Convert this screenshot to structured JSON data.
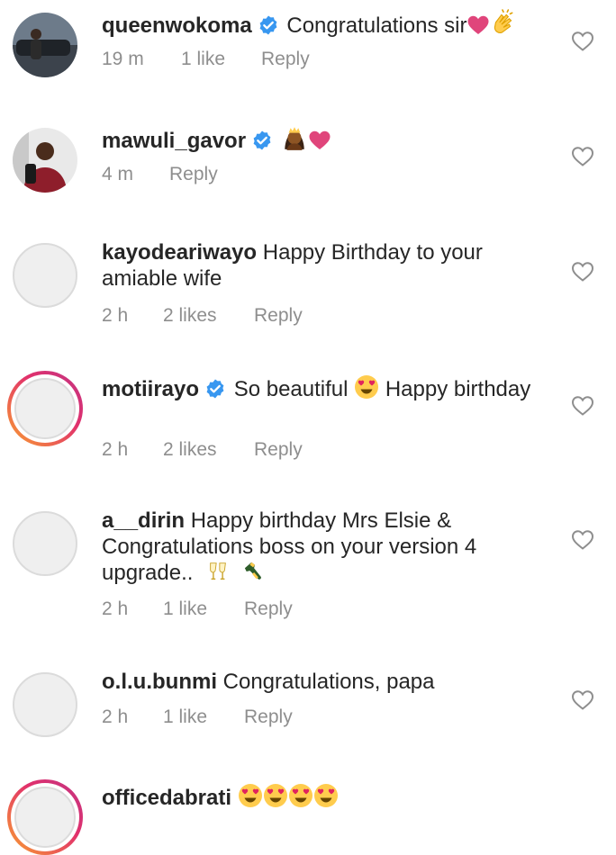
{
  "colors": {
    "text": "#262626",
    "muted": "#8e8e8e",
    "verified": "#3897f0",
    "heart_emoji": "#e0457b"
  },
  "comments": [
    {
      "username": "queenwokoma",
      "verified": true,
      "text": "Congratulations sir",
      "emojis": [
        "heart",
        "clapping-hands"
      ],
      "time": "19 m",
      "likes": "1 like",
      "reply": "Reply",
      "avatar": "photo"
    },
    {
      "username": "mawuli_gavor",
      "verified": true,
      "text": "",
      "emojis": [
        "princess",
        "heart"
      ],
      "time": "4 m",
      "likes": "",
      "reply": "Reply",
      "avatar": "photo"
    },
    {
      "username": "kayodeariwayo",
      "verified": false,
      "text": "Happy Birthday to your amiable wife",
      "time": "2 h",
      "likes": "2 likes",
      "reply": "Reply",
      "avatar": "blank"
    },
    {
      "username": "motiirayo",
      "verified": true,
      "text_before": "So beautiful",
      "text_after": "Happy birthday",
      "emojis": [
        "heart-eyes"
      ],
      "time": "2 h",
      "likes": "2 likes",
      "reply": "Reply",
      "avatar": "story"
    },
    {
      "username": "a__dirin",
      "verified": false,
      "text": "Happy birthday Mrs Elsie & Congratulations boss on your version 4 upgrade..",
      "emojis": [
        "clinking-glasses",
        "champagne"
      ],
      "time": "2 h",
      "likes": "1 like",
      "reply": "Reply",
      "avatar": "blank"
    },
    {
      "username": "o.l.u.bunmi",
      "verified": false,
      "text": "Congratulations, papa",
      "time": "2 h",
      "likes": "1 like",
      "reply": "Reply",
      "avatar": "blank"
    },
    {
      "username": "officedabrati",
      "verified": false,
      "text": "",
      "emojis": [
        "heart-eyes",
        "heart-eyes",
        "heart-eyes",
        "heart-eyes"
      ],
      "avatar": "story"
    }
  ]
}
